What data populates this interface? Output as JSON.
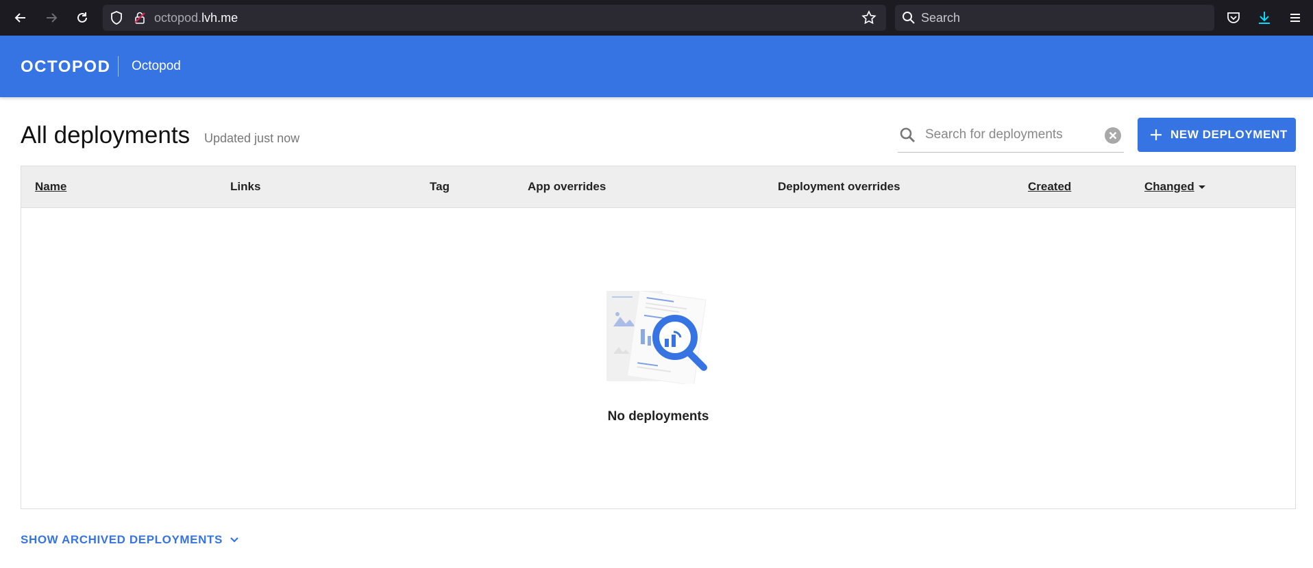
{
  "browser": {
    "url_dim": "octopod.",
    "url_main": "lvh.me",
    "search_placeholder": "Search",
    "icons": [
      "back-icon",
      "forward-icon",
      "reload-icon",
      "shield-icon",
      "lock-icon",
      "star-icon",
      "search-icon",
      "pocket-icon",
      "download-icon",
      "menu-icon"
    ]
  },
  "header": {
    "brand": "OCTOPOD",
    "project": "Octopod"
  },
  "page": {
    "title": "All deployments",
    "updated": "Updated just now",
    "search_placeholder": "Search for deployments",
    "new_button_label": "NEW DEPLOYMENT"
  },
  "table": {
    "columns": [
      "Name",
      "Links",
      "Tag",
      "App overrides",
      "Deployment overrides",
      "Created",
      "Changed"
    ],
    "sortable": [
      "Name",
      "Created",
      "Changed"
    ],
    "sorted_by": "Changed",
    "empty_text": "No deployments"
  },
  "footer": {
    "archived_label": "SHOW ARCHIVED DEPLOYMENTS"
  },
  "colors": {
    "accent": "#3673e3",
    "browser_bg": "#1c1b22",
    "table_header_bg": "#eeeeee"
  }
}
